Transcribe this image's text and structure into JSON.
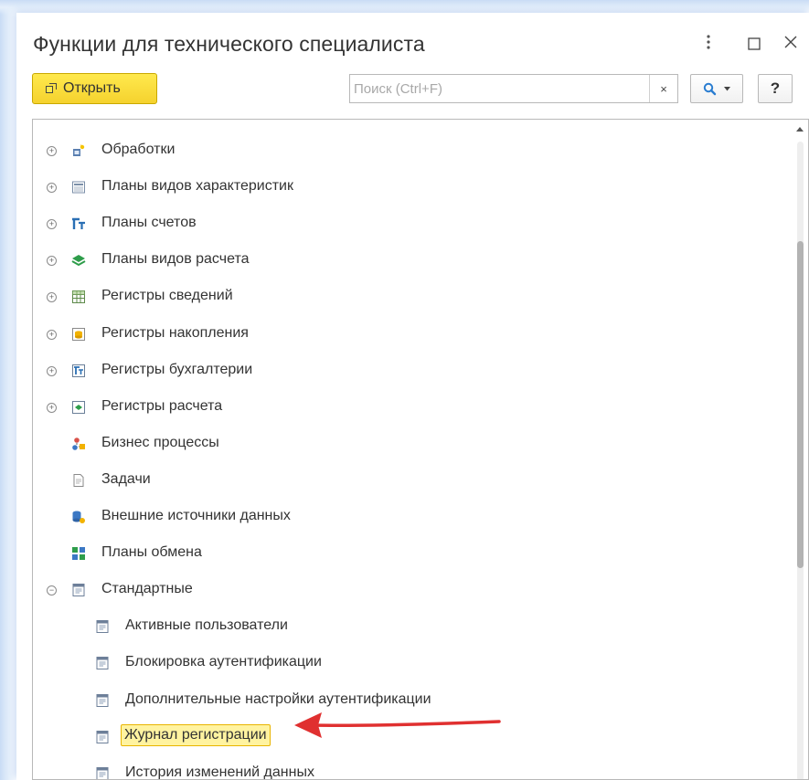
{
  "window": {
    "title": "Функции для технического специалиста",
    "menu_icon": "more-vertical-icon",
    "maximize_icon": "maximize-icon",
    "close_icon": "close-icon"
  },
  "toolbar": {
    "open_label": "Открыть",
    "search_placeholder": "Поиск (Ctrl+F)",
    "search_value": "",
    "clear_label": "×",
    "help_label": "?"
  },
  "colors": {
    "accent_button": "#f5d22e",
    "highlight": "#fff3a0",
    "arrow": "#e03030"
  },
  "tree": {
    "items": [
      {
        "label": "Обработки",
        "icon": "data-processor-icon",
        "expander": "⊕"
      },
      {
        "label": "Планы видов характеристик",
        "icon": "chart-of-characteristic-types-icon",
        "expander": "⊕"
      },
      {
        "label": "Планы счетов",
        "icon": "chart-of-accounts-icon",
        "expander": "⊕"
      },
      {
        "label": "Планы видов расчета",
        "icon": "chart-of-calculation-types-icon",
        "expander": "⊕"
      },
      {
        "label": "Регистры сведений",
        "icon": "information-register-icon",
        "expander": "⊕"
      },
      {
        "label": "Регистры накопления",
        "icon": "accumulation-register-icon",
        "expander": "⊕"
      },
      {
        "label": "Регистры бухгалтерии",
        "icon": "accounting-register-icon",
        "expander": "⊕"
      },
      {
        "label": "Регистры расчета",
        "icon": "calculation-register-icon",
        "expander": "⊕"
      },
      {
        "label": "Бизнес процессы",
        "icon": "business-process-icon",
        "expander": ""
      },
      {
        "label": "Задачи",
        "icon": "task-icon",
        "expander": ""
      },
      {
        "label": "Внешние источники данных",
        "icon": "external-data-source-icon",
        "expander": ""
      },
      {
        "label": "Планы обмена",
        "icon": "exchange-plan-icon",
        "expander": ""
      },
      {
        "label": "Стандартные",
        "icon": "standard-functions-icon",
        "expander": "⊖"
      },
      {
        "label": "Активные пользователи",
        "icon": "form-icon",
        "expander": ""
      },
      {
        "label": "Блокировка аутентификации",
        "icon": "form-icon",
        "expander": ""
      },
      {
        "label": "Дополнительные настройки аутентификации",
        "icon": "form-icon",
        "expander": ""
      },
      {
        "label": "Журнал регистрации",
        "icon": "form-icon",
        "expander": ""
      },
      {
        "label": "История изменений данных",
        "icon": "form-icon",
        "expander": ""
      }
    ]
  }
}
